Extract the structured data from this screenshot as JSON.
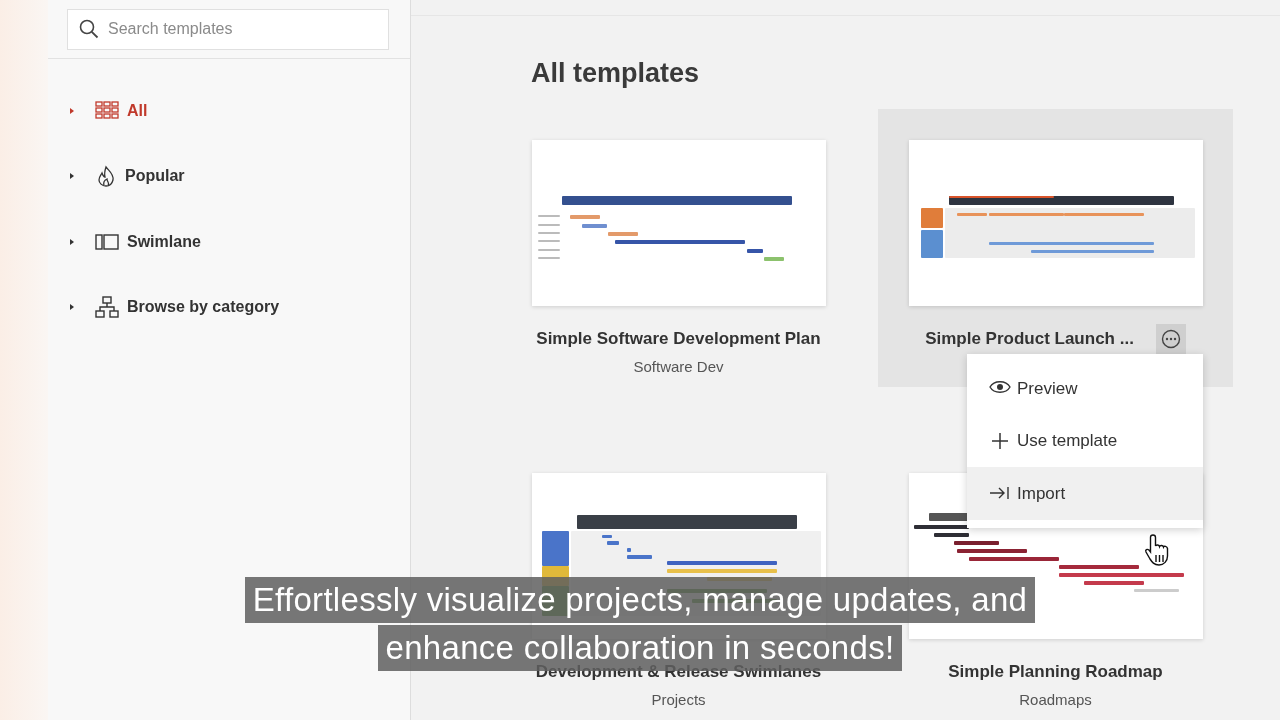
{
  "search": {
    "placeholder": "Search templates"
  },
  "sidebar": {
    "items": [
      {
        "label": "All",
        "selected": true
      },
      {
        "label": "Popular",
        "selected": false
      },
      {
        "label": "Swimlane",
        "selected": false
      },
      {
        "label": "Browse by category",
        "selected": false
      }
    ]
  },
  "heading": "All templates",
  "templates": [
    {
      "title": "Simple Software Development Plan",
      "category": "Software Dev",
      "hovered": false
    },
    {
      "title": "Simple Product Launch ...",
      "hovered": true
    },
    {
      "title": "Development & Release Swimlanes",
      "category": "Projects",
      "hovered": false
    },
    {
      "title": "Simple Planning Roadmap",
      "category": "Roadmaps",
      "hovered": false
    }
  ],
  "menu": {
    "items": [
      {
        "label": "Preview",
        "hovered": false
      },
      {
        "label": "Use template",
        "hovered": false
      },
      {
        "label": "Import",
        "hovered": true
      }
    ]
  },
  "caption": [
    "Effortlessly visualize projects, manage updates, and",
    "enhance collaboration in seconds!"
  ]
}
